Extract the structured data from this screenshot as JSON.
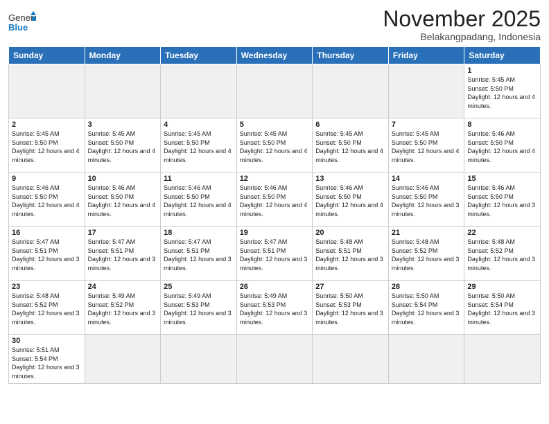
{
  "logo": {
    "general": "General",
    "blue": "Blue"
  },
  "title": "November 2025",
  "location": "Belakangpadang, Indonesia",
  "weekdays": [
    "Sunday",
    "Monday",
    "Tuesday",
    "Wednesday",
    "Thursday",
    "Friday",
    "Saturday"
  ],
  "days": {
    "1": {
      "sunrise": "5:45 AM",
      "sunset": "5:50 PM",
      "daylight": "12 hours and 4 minutes."
    },
    "2": {
      "sunrise": "5:45 AM",
      "sunset": "5:50 PM",
      "daylight": "12 hours and 4 minutes."
    },
    "3": {
      "sunrise": "5:45 AM",
      "sunset": "5:50 PM",
      "daylight": "12 hours and 4 minutes."
    },
    "4": {
      "sunrise": "5:45 AM",
      "sunset": "5:50 PM",
      "daylight": "12 hours and 4 minutes."
    },
    "5": {
      "sunrise": "5:45 AM",
      "sunset": "5:50 PM",
      "daylight": "12 hours and 4 minutes."
    },
    "6": {
      "sunrise": "5:45 AM",
      "sunset": "5:50 PM",
      "daylight": "12 hours and 4 minutes."
    },
    "7": {
      "sunrise": "5:45 AM",
      "sunset": "5:50 PM",
      "daylight": "12 hours and 4 minutes."
    },
    "8": {
      "sunrise": "5:46 AM",
      "sunset": "5:50 PM",
      "daylight": "12 hours and 4 minutes."
    },
    "9": {
      "sunrise": "5:46 AM",
      "sunset": "5:50 PM",
      "daylight": "12 hours and 4 minutes."
    },
    "10": {
      "sunrise": "5:46 AM",
      "sunset": "5:50 PM",
      "daylight": "12 hours and 4 minutes."
    },
    "11": {
      "sunrise": "5:46 AM",
      "sunset": "5:50 PM",
      "daylight": "12 hours and 4 minutes."
    },
    "12": {
      "sunrise": "5:46 AM",
      "sunset": "5:50 PM",
      "daylight": "12 hours and 4 minutes."
    },
    "13": {
      "sunrise": "5:46 AM",
      "sunset": "5:50 PM",
      "daylight": "12 hours and 4 minutes."
    },
    "14": {
      "sunrise": "5:46 AM",
      "sunset": "5:50 PM",
      "daylight": "12 hours and 3 minutes."
    },
    "15": {
      "sunrise": "5:46 AM",
      "sunset": "5:50 PM",
      "daylight": "12 hours and 3 minutes."
    },
    "16": {
      "sunrise": "5:47 AM",
      "sunset": "5:51 PM",
      "daylight": "12 hours and 3 minutes."
    },
    "17": {
      "sunrise": "5:47 AM",
      "sunset": "5:51 PM",
      "daylight": "12 hours and 3 minutes."
    },
    "18": {
      "sunrise": "5:47 AM",
      "sunset": "5:51 PM",
      "daylight": "12 hours and 3 minutes."
    },
    "19": {
      "sunrise": "5:47 AM",
      "sunset": "5:51 PM",
      "daylight": "12 hours and 3 minutes."
    },
    "20": {
      "sunrise": "5:48 AM",
      "sunset": "5:51 PM",
      "daylight": "12 hours and 3 minutes."
    },
    "21": {
      "sunrise": "5:48 AM",
      "sunset": "5:52 PM",
      "daylight": "12 hours and 3 minutes."
    },
    "22": {
      "sunrise": "5:48 AM",
      "sunset": "5:52 PM",
      "daylight": "12 hours and 3 minutes."
    },
    "23": {
      "sunrise": "5:48 AM",
      "sunset": "5:52 PM",
      "daylight": "12 hours and 3 minutes."
    },
    "24": {
      "sunrise": "5:49 AM",
      "sunset": "5:52 PM",
      "daylight": "12 hours and 3 minutes."
    },
    "25": {
      "sunrise": "5:49 AM",
      "sunset": "5:53 PM",
      "daylight": "12 hours and 3 minutes."
    },
    "26": {
      "sunrise": "5:49 AM",
      "sunset": "5:53 PM",
      "daylight": "12 hours and 3 minutes."
    },
    "27": {
      "sunrise": "5:50 AM",
      "sunset": "5:53 PM",
      "daylight": "12 hours and 3 minutes."
    },
    "28": {
      "sunrise": "5:50 AM",
      "sunset": "5:54 PM",
      "daylight": "12 hours and 3 minutes."
    },
    "29": {
      "sunrise": "5:50 AM",
      "sunset": "5:54 PM",
      "daylight": "12 hours and 3 minutes."
    },
    "30": {
      "sunrise": "5:51 AM",
      "sunset": "5:54 PM",
      "daylight": "12 hours and 3 minutes."
    }
  }
}
